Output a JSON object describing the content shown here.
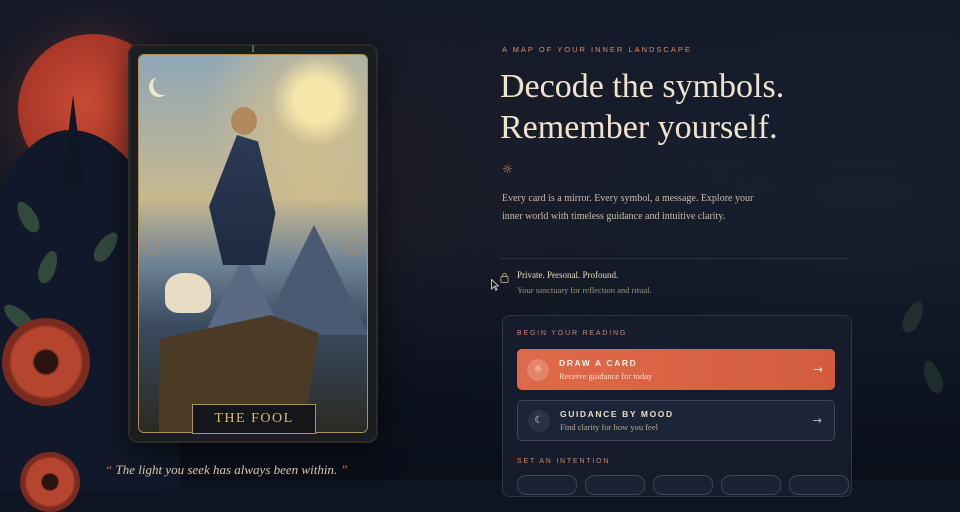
{
  "hero_card": {
    "numeral": "I",
    "name": "THE FOOL"
  },
  "quote": {
    "open_mark": "“",
    "text": " The light you seek has always been within. ",
    "close_mark": "”"
  },
  "hero": {
    "kicker": "A MAP OF YOUR INNER LANDSCAPE",
    "title_line1": "Decode the symbols.",
    "title_line2": "Remember yourself.",
    "sparkle": "☼",
    "description": "Every card is a mirror. Every symbol, a message. Explore your inner world with timeless guidance and intuitive clarity."
  },
  "privacy": {
    "icon": "lock-icon",
    "title": "Private. Personal. Profound.",
    "subtitle": "Your sanctuary for reflection and ritual."
  },
  "reading_panel": {
    "label": "BEGIN YOUR READING",
    "actions": [
      {
        "icon": "sun-icon",
        "glyph": "☼",
        "title": "DRAW A CARD",
        "subtitle": "Receive guidance for today",
        "arrow": "→"
      },
      {
        "icon": "moon-icon",
        "glyph": "☾",
        "title": "GUIDANCE BY MOOD",
        "subtitle": "Find clarity for how you feel",
        "arrow": "→"
      }
    ],
    "intention_label": "SET AN INTENTION"
  },
  "colors": {
    "accent": "#df6a49",
    "gold": "#b08f5a",
    "background": "#0f1422"
  }
}
